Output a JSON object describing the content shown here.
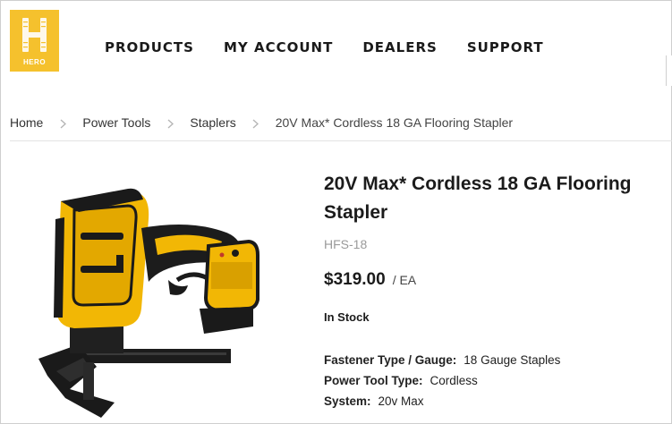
{
  "brand": {
    "logo_text": "HERO",
    "accent": "#f5c12d"
  },
  "nav": {
    "items": [
      "PRODUCTS",
      "MY ACCOUNT",
      "DEALERS",
      "SUPPORT"
    ]
  },
  "breadcrumb": [
    "Home",
    "Power Tools",
    "Staplers",
    "20V Max* Cordless 18 GA Flooring Stapler"
  ],
  "product": {
    "title": "20V Max* Cordless 18 GA Flooring Stapler",
    "sku": "HFS-18",
    "price": "$319.00",
    "unit": "/ EA",
    "stock": "In Stock",
    "image_icon": "flooring-stapler-image",
    "specs": [
      {
        "label": "Fastener Type / Gauge:",
        "value": "18 Gauge Staples"
      },
      {
        "label": "Power Tool Type:",
        "value": "Cordless"
      },
      {
        "label": "System:",
        "value": "20v Max"
      }
    ]
  }
}
